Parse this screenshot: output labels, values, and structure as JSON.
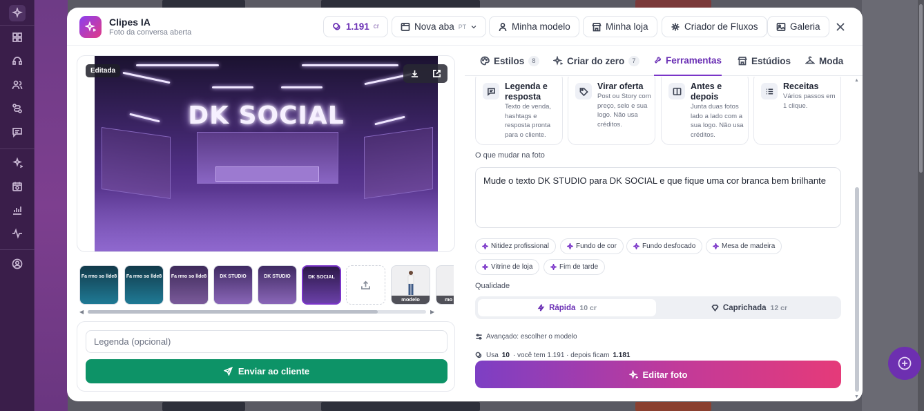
{
  "header": {
    "title": "Clipes IA",
    "subtitle": "Foto da conversa aberta",
    "credits_value": "1.191",
    "credits_unit": "cr",
    "new_tab_label": "Nova aba",
    "language_tag": "PT",
    "model_label": "Minha modelo",
    "store_label": "Minha loja",
    "flows_label": "Criador de Fluxos",
    "gallery_label": "Galeria"
  },
  "preview": {
    "badge": "Editada",
    "neon_text": "DK SOCIAL"
  },
  "thumbnails": [
    {
      "text": "Fa rmo so llde8",
      "tint": "#1f6f86"
    },
    {
      "text": "Fa rmo so llde8",
      "tint": "#1f6f86"
    },
    {
      "text": "Fa rmo so llde8",
      "tint": "#6a4a8c"
    },
    {
      "text": "DK STUDIO",
      "tint": "#7a55a8"
    },
    {
      "text": "DK STUDIO",
      "tint": "#7a55a8"
    },
    {
      "text": "DK SOCIAL",
      "tint": "#5a2f8f"
    }
  ],
  "model_thumb_label": "modelo",
  "model_thumb_label_partial": "mo",
  "send": {
    "caption_placeholder": "Legenda (opcional)",
    "send_label": "Enviar ao cliente"
  },
  "tabs": [
    {
      "label": "Estilos",
      "count": "8"
    },
    {
      "label": "Criar do zero",
      "count": "7"
    },
    {
      "label": "Ferramentas",
      "count": ""
    },
    {
      "label": "Estúdios",
      "count": ""
    },
    {
      "label": "Moda",
      "count": ""
    }
  ],
  "tools": [
    {
      "title": "Legenda e resposta",
      "desc": "Texto de venda, hashtags e resposta pronta para o cliente.",
      "icon": "message-icon"
    },
    {
      "title": "Virar oferta",
      "desc": "Post ou Story com preço, selo e sua logo. Não usa créditos.",
      "icon": "tag-icon"
    },
    {
      "title": "Antes e depois",
      "desc": "Junta duas fotos lado a lado com a sua logo. Não usa créditos.",
      "icon": "split-icon"
    },
    {
      "title": "Receitas",
      "desc": "Vários passos em 1 clique.",
      "icon": "list-icon"
    }
  ],
  "prompt": {
    "label": "O que mudar na foto",
    "value": "Mude o texto DK STUDIO para DK SOCIAL e que fique uma cor branca bem brilhante"
  },
  "chips": [
    "Nitidez profissional",
    "Fundo de cor",
    "Fundo desfocado",
    "Mesa de madeira",
    "Vitrine de loja",
    "Fim de tarde"
  ],
  "quality": {
    "label": "Qualidade",
    "fast_label": "Rápida",
    "fast_cost": "10 cr",
    "careful_label": "Caprichada",
    "careful_cost": "12 cr",
    "selected": "Rápida"
  },
  "advanced_label": "Avançado: escolher o modelo",
  "usage": {
    "prefix": "Usa",
    "cost": "10",
    "middle": "· você tem 1.191 · depois ficam",
    "after": "1.181"
  },
  "edit_label": "Editar foto",
  "colors": {
    "accent": "#7a35c8",
    "send_green": "#0d9367",
    "edit_gradient_start": "#7d3fc4",
    "edit_gradient_end": "#e53a79"
  }
}
